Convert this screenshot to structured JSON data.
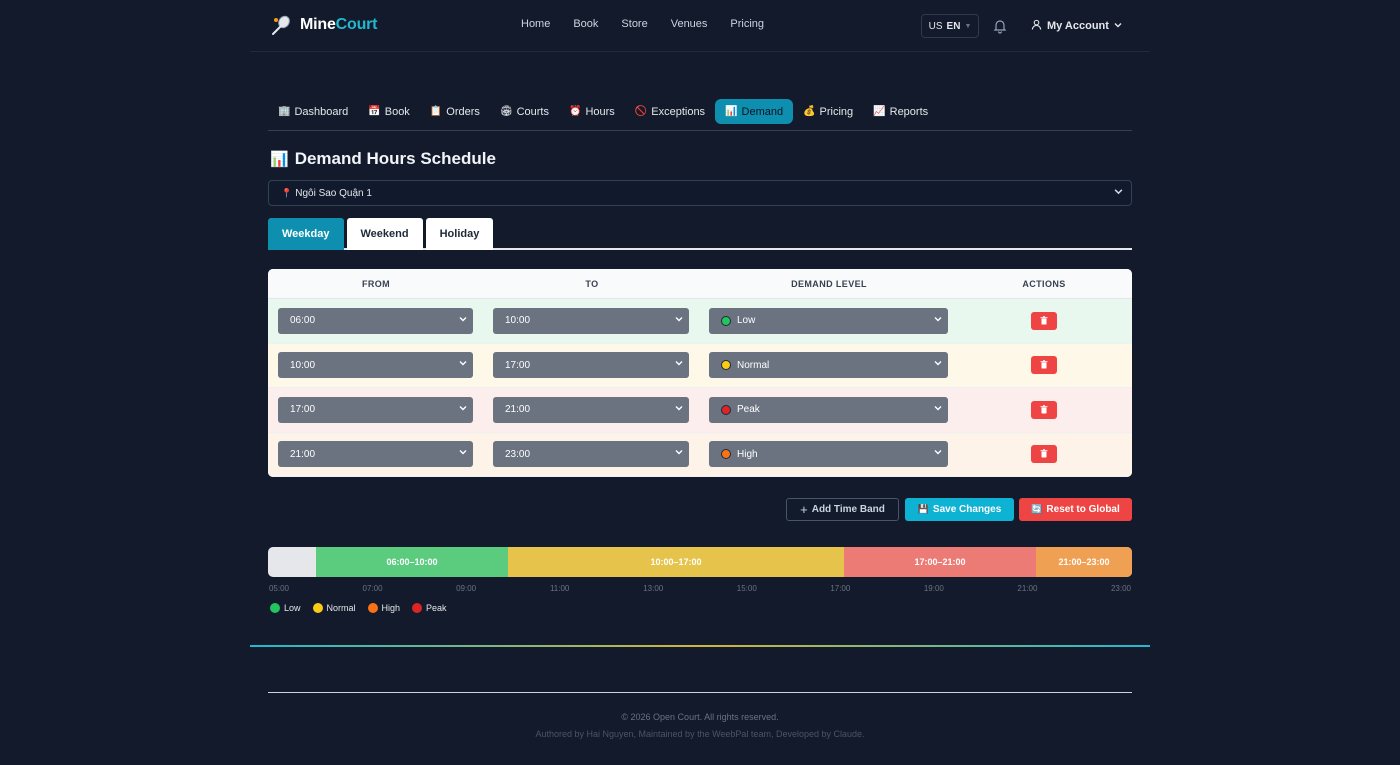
{
  "brand": {
    "name_part1": "Mine",
    "name_part2": "Court"
  },
  "nav": {
    "links": [
      "Home",
      "Book",
      "Store",
      "Venues",
      "Pricing"
    ],
    "language": {
      "flag": "US",
      "code": "EN"
    },
    "account_label": "My Account"
  },
  "admin_tabs": [
    {
      "icon": "🏢",
      "label": "Dashboard",
      "active": false
    },
    {
      "icon": "📅",
      "label": "Book",
      "active": false
    },
    {
      "icon": "📋",
      "label": "Orders",
      "active": false
    },
    {
      "icon": "🏟",
      "label": "Courts",
      "active": false
    },
    {
      "icon": "⏰",
      "label": "Hours",
      "active": false
    },
    {
      "icon": "🚫",
      "label": "Exceptions",
      "active": false
    },
    {
      "icon": "📊",
      "label": "Demand",
      "active": true
    },
    {
      "icon": "💰",
      "label": "Pricing",
      "active": false
    },
    {
      "icon": "📈",
      "label": "Reports",
      "active": false
    }
  ],
  "page": {
    "title_icon": "📊",
    "title": "Demand Hours Schedule",
    "venue_icon": "📍",
    "venue": "Ngôi Sao Quận 1"
  },
  "day_tabs": [
    {
      "label": "Weekday",
      "active": true
    },
    {
      "label": "Weekend",
      "active": false
    },
    {
      "label": "Holiday",
      "active": false
    }
  ],
  "table": {
    "headers": {
      "from": "FROM",
      "to": "TO",
      "level": "DEMAND LEVEL",
      "actions": "ACTIONS"
    },
    "rows": [
      {
        "from": "06:00",
        "to": "10:00",
        "level": "Low",
        "level_color": "#22c55e",
        "tint": "low"
      },
      {
        "from": "10:00",
        "to": "17:00",
        "level": "Normal",
        "level_color": "#facc15",
        "tint": "normal"
      },
      {
        "from": "17:00",
        "to": "21:00",
        "level": "Peak",
        "level_color": "#dc2626",
        "tint": "peak"
      },
      {
        "from": "21:00",
        "to": "23:00",
        "level": "High",
        "level_color": "#f97316",
        "tint": "high"
      }
    ]
  },
  "buttons": {
    "add": "Add Time Band",
    "save": "Save Changes",
    "save_icon": "💾",
    "reset": "Reset to Global",
    "reset_icon": "🔄"
  },
  "timeline": {
    "range_start": 5,
    "range_end": 23,
    "segments": [
      {
        "label": "06:00–10:00",
        "start": 6,
        "end": 10,
        "color": "#5bcc7e"
      },
      {
        "label": "10:00–17:00",
        "start": 10,
        "end": 17,
        "color": "#e6c34a"
      },
      {
        "label": "17:00–21:00",
        "start": 17,
        "end": 21,
        "color": "#ec7b75"
      },
      {
        "label": "21:00–23:00",
        "start": 21,
        "end": 23,
        "color": "#f0a052"
      }
    ],
    "ticks": [
      "05:00",
      "07:00",
      "09:00",
      "11:00",
      "13:00",
      "15:00",
      "17:00",
      "19:00",
      "21:00",
      "23:00"
    ]
  },
  "legend": [
    {
      "label": "Low",
      "color": "#22c55e"
    },
    {
      "label": "Normal",
      "color": "#facc15"
    },
    {
      "label": "High",
      "color": "#f97316"
    },
    {
      "label": "Peak",
      "color": "#dc2626"
    }
  ],
  "footer": {
    "copyright": "© 2026 Open Court. All rights reserved.",
    "authors": "Authored by Hai Nguyen, Maintained by the WeebPal team, Developed by Claude."
  }
}
